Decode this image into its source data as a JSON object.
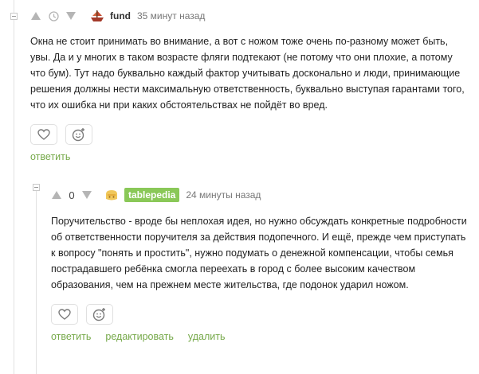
{
  "comments": [
    {
      "score": "",
      "username": "fund",
      "time": "35 минут назад",
      "text": "Окна не стоит принимать во внимание, а вот с ножом тоже очень по-разному может быть, увы. Да и у многих в таком возрасте фляги подтекают (не потому что они плохие, а потому что бум). Тут надо буквально каждый фактор учитывать досконально и люди, принимающие решения должны нести максимальную ответственность, буквально выступая гарантами того, что их ошибка ни при каких обстоятельствах не пойдёт во вред.",
      "links": {
        "reply": "ответить"
      }
    },
    {
      "score": "0",
      "username": "tablepedia",
      "time": "24 минуты назад",
      "text": "Поручительство - вроде бы неплохая идея, но нужно обсуждать конкретные подробности об ответственности поручителя за действия подопечного. И ещё, прежде чем приступать к вопросу \"понять и простить\", нужно подумать о денежной компенсации, чтобы семья пострадавшего ребёнка смогла переехать в город с более высоким качеством образования, чем на прежнем месте жительства, где подонок ударил ножом.",
      "links": {
        "reply": "ответить",
        "edit": "редактировать",
        "delete": "удалить"
      }
    }
  ],
  "icons": {
    "upvote": "triangle-up-icon",
    "downvote": "triangle-down-icon",
    "pending": "clock-icon",
    "like": "heart-icon",
    "react": "smiley-add-icon"
  },
  "colors": {
    "link": "#76a94a",
    "badge": "#8ac858"
  }
}
